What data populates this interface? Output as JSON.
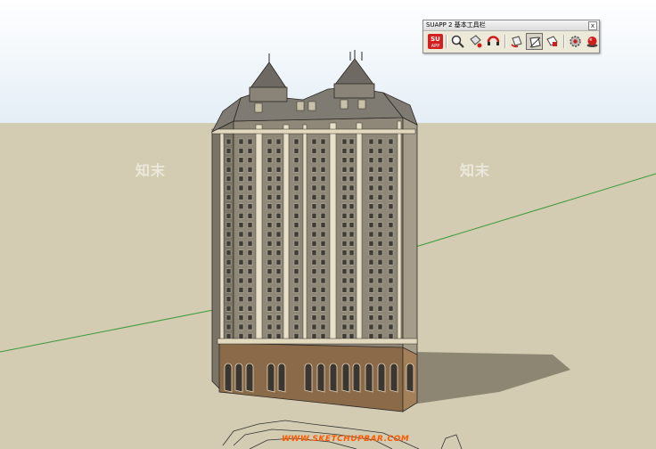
{
  "toolbar": {
    "title": "SUAPP 2 基本工具栏",
    "close_symbol": "x",
    "buttons": [
      {
        "name": "suapp-logo-button",
        "icon": "su-logo-icon",
        "top_text": "SU",
        "bottom_text": "APP"
      },
      {
        "name": "search-button",
        "icon": "magnifier-icon"
      },
      {
        "name": "paint-tool-button",
        "icon": "paint-icon"
      },
      {
        "name": "orbit-button",
        "icon": "orbit-icon"
      },
      {
        "name": "rotate-button",
        "icon": "rotate-icon"
      },
      {
        "name": "section-plane-button",
        "icon": "section-icon",
        "active": true
      },
      {
        "name": "move-button",
        "icon": "move-icon"
      },
      {
        "name": "settings-button",
        "icon": "gear-icon"
      },
      {
        "name": "red-ball-button",
        "icon": "red-ball-icon"
      }
    ]
  },
  "viewport": {
    "sky_color": "#eef3f8",
    "ground_color": "#d3ccb2",
    "watermarks": [
      "知末",
      "知末"
    ],
    "site_link": "WWW.SKETCHUPBAR.COM"
  }
}
